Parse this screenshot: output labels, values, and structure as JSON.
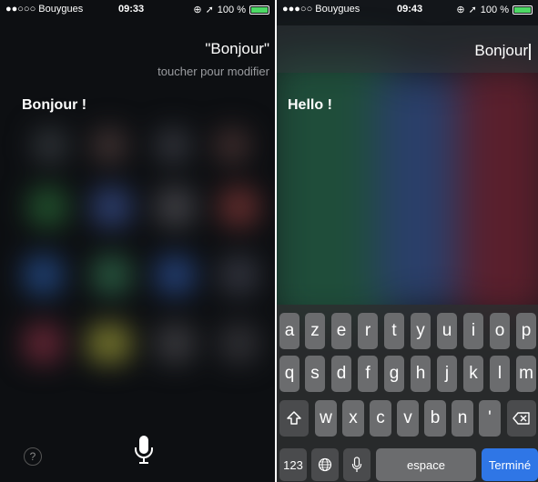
{
  "left": {
    "status": {
      "carrier": "●●○○○ Bouygues",
      "time": "09:33",
      "battery": "100 %"
    },
    "query": "\"Bonjour\"",
    "hint": "toucher pour modifier",
    "reply": "Bonjour !",
    "help": "?"
  },
  "right": {
    "status": {
      "carrier": "●●●○○ Bouygues",
      "time": "09:43",
      "battery": "100 %"
    },
    "input_text": "Bonjour",
    "reply": "Hello !",
    "keyboard": {
      "row1": [
        "a",
        "z",
        "e",
        "r",
        "t",
        "y",
        "u",
        "i",
        "o",
        "p"
      ],
      "row2": [
        "q",
        "s",
        "d",
        "f",
        "g",
        "h",
        "j",
        "k",
        "l",
        "m"
      ],
      "row3": [
        "w",
        "x",
        "c",
        "v",
        "b",
        "n",
        "'"
      ],
      "numbers": "123",
      "space": "espace",
      "done": "Terminé"
    }
  }
}
